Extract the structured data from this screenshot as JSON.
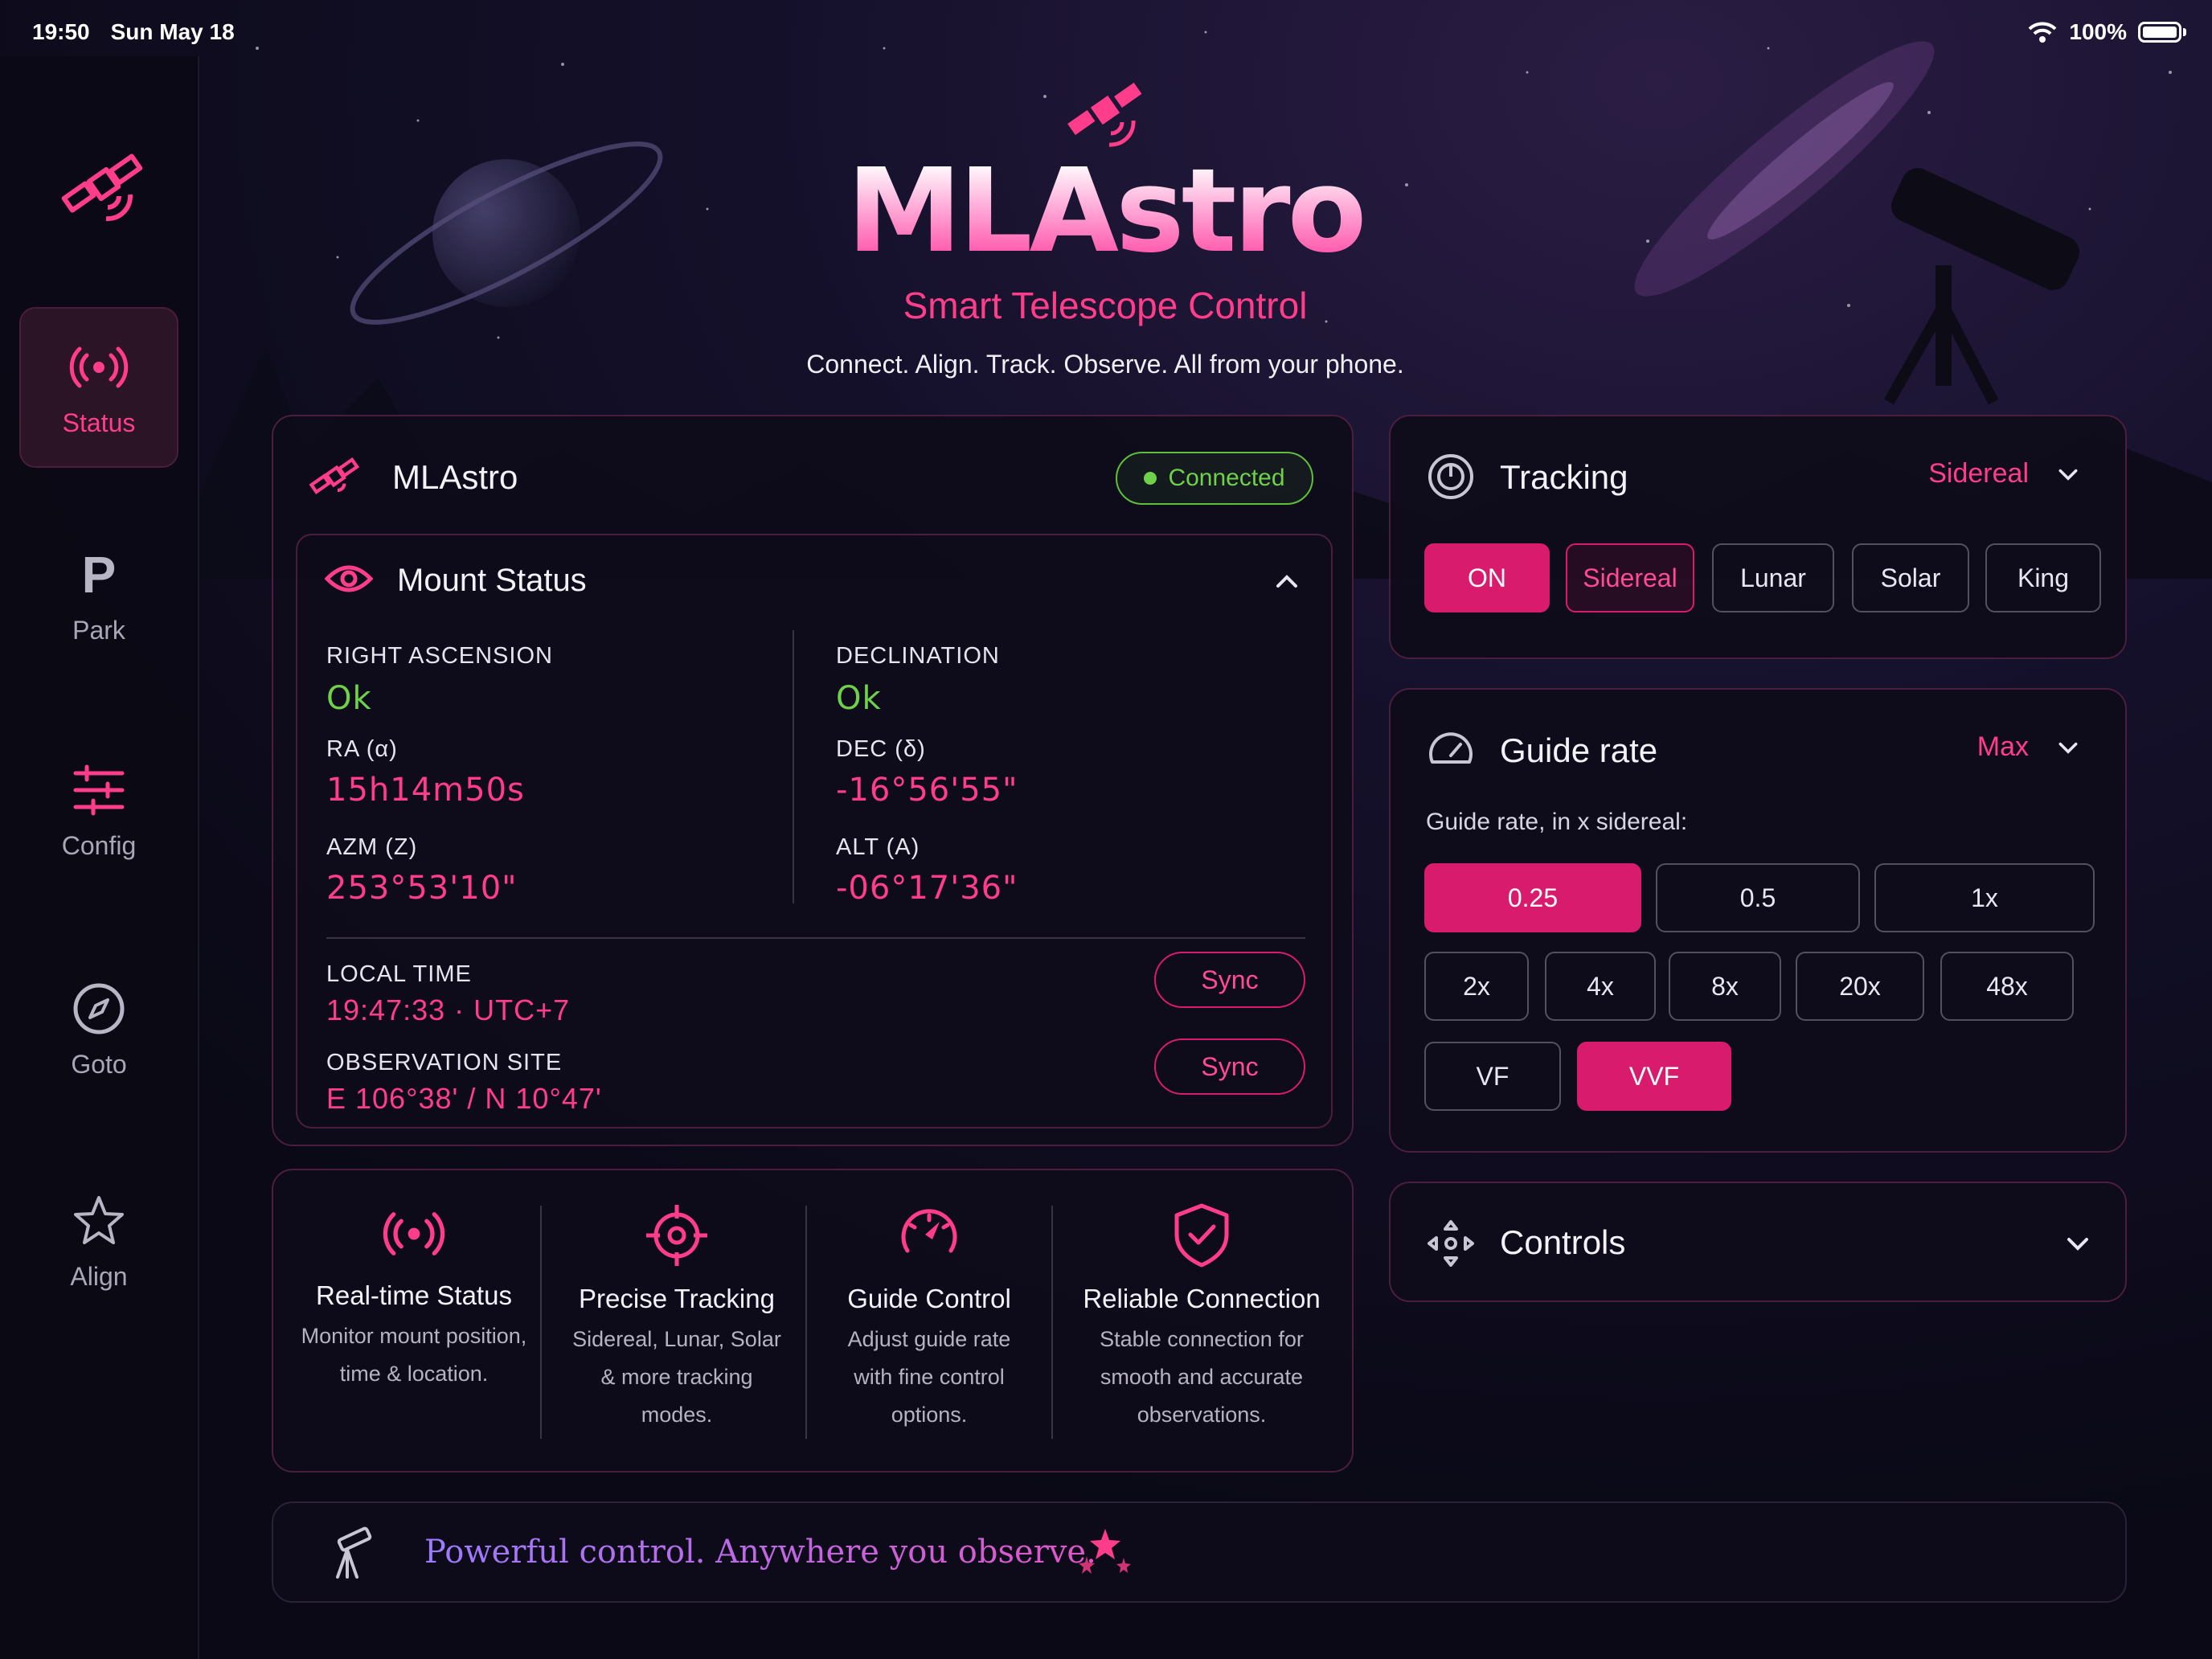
{
  "status_bar": {
    "time": "19:50",
    "date": "Sun May 18",
    "battery": "100%"
  },
  "sidebar": {
    "items": [
      {
        "label": "Status",
        "icon": "broadcast-icon",
        "active": true
      },
      {
        "label": "Park",
        "icon": "parking-icon",
        "glyph": "P"
      },
      {
        "label": "Config",
        "icon": "sliders-icon"
      },
      {
        "label": "Goto",
        "icon": "compass-icon"
      },
      {
        "label": "Align",
        "icon": "star-icon"
      }
    ]
  },
  "brand": {
    "title": "MLAstro",
    "subtitle": "Smart Telescope Control",
    "tagline": "Connect. Align. Track. Observe. All from your phone."
  },
  "device": {
    "name": "MLAstro",
    "connection": "Connected"
  },
  "mount": {
    "title": "Mount Status",
    "ra_status_label": "RIGHT ASCENSION",
    "ra_status": "Ok",
    "dec_status_label": "DECLINATION",
    "dec_status": "Ok",
    "ra_label": "RA (α)",
    "ra": "15h14m50s",
    "dec_label": "DEC (δ)",
    "dec": "-16°56'55\"",
    "azm_label": "AZM (Z)",
    "azm": "253°53'10\"",
    "alt_label": "ALT (A)",
    "alt": "-06°17'36\"",
    "time_label": "LOCAL TIME",
    "time": "19:47:33 · UTC+7",
    "site_label": "OBSERVATION SITE",
    "site": "E 106°38' / N 10°47'",
    "sync_label": "Sync"
  },
  "features": [
    {
      "title": "Real-time Status",
      "desc": [
        "Monitor mount position,",
        "time & location."
      ],
      "icon": "broadcast-icon"
    },
    {
      "title": "Precise Tracking",
      "desc": [
        "Sidereal, Lunar, Solar",
        "& more tracking",
        "modes."
      ],
      "icon": "crosshair-icon"
    },
    {
      "title": "Guide Control",
      "desc": [
        "Adjust guide rate",
        "with fine control",
        "options."
      ],
      "icon": "gauge-icon"
    },
    {
      "title": "Reliable Connection",
      "desc": [
        "Stable connection for",
        "smooth and accurate",
        "observations."
      ],
      "icon": "shield-check-icon"
    }
  ],
  "footer": {
    "text": "Powerful control. Anywhere you observe."
  },
  "tracking": {
    "title": "Tracking",
    "selected": "Sidereal",
    "buttons": [
      {
        "label": "ON",
        "state": "on"
      },
      {
        "label": "Sidereal",
        "state": "selected"
      },
      {
        "label": "Lunar",
        "state": "off"
      },
      {
        "label": "Solar",
        "state": "off"
      },
      {
        "label": "King",
        "state": "off"
      }
    ]
  },
  "guide": {
    "title": "Guide rate",
    "selected": "Max",
    "caption": "Guide rate, in x sidereal:",
    "buttons": [
      {
        "label": "0.25",
        "state": "on"
      },
      {
        "label": "0.5",
        "state": "off"
      },
      {
        "label": "1x",
        "state": "off"
      },
      {
        "label": "2x",
        "state": "off"
      },
      {
        "label": "4x",
        "state": "off"
      },
      {
        "label": "8x",
        "state": "off"
      },
      {
        "label": "20x",
        "state": "off"
      },
      {
        "label": "48x",
        "state": "off"
      },
      {
        "label": "VF",
        "state": "off"
      },
      {
        "label": "VVF",
        "state": "on"
      }
    ]
  },
  "controls": {
    "title": "Controls"
  },
  "colors": {
    "accent": "#ff3d8b",
    "accent_fill": "#d91b6d",
    "ok": "#6fd14a",
    "panel": "#0e0c1a",
    "border": "#4b1e3f"
  }
}
